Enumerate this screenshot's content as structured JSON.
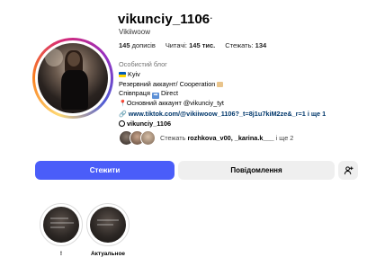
{
  "profile": {
    "username": "vikunciy_1106",
    "more_glyph": "···",
    "full_name": "Vikiiwoow"
  },
  "stats": {
    "posts_count": "145",
    "posts_label": "дописів",
    "followers_label": "Читачі:",
    "followers_count": "145 тис.",
    "following_label": "Стежать:",
    "following_count": "134"
  },
  "bio": {
    "category": "Особистий блог",
    "line_location": "Kyiv",
    "line_reserve": "Резервний аккаунт/ Cooperation",
    "line_coop_prefix": "Співпраця",
    "line_coop_suffix": "Direct",
    "line_main": "Основний аккаунт @vikunciy_tyt",
    "link": "www.tiktok.com/@vikiiwoow_1106?_t=8j1u7kiM2ze&_r=1 і ще 1",
    "threads": "vikunciy_1106"
  },
  "followed_by": {
    "prefix": "Стежать",
    "names": "rozhkova_v00, _karina.k___",
    "suffix": "і ще 2"
  },
  "buttons": {
    "follow": "Стежити",
    "message": "Повідомлення",
    "suggest_icon": "add-person-icon"
  },
  "highlights": [
    {
      "label": "!"
    },
    {
      "label": "Актуальное"
    }
  ],
  "colors": {
    "follow_button": "#4a5df9",
    "link": "#00376b",
    "secondary_button": "#efefef"
  }
}
